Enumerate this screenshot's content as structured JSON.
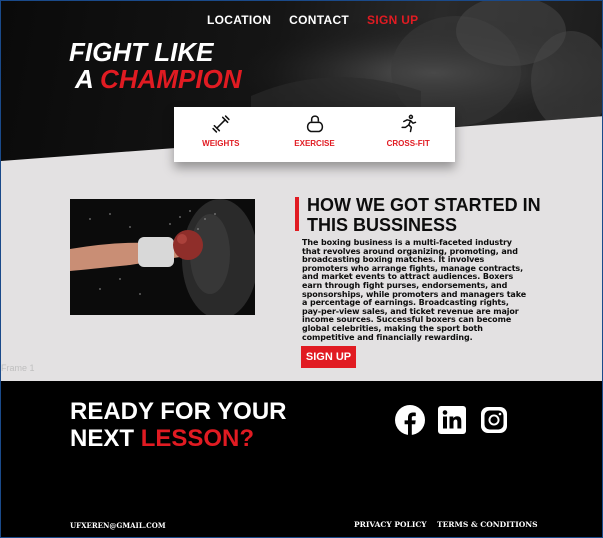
{
  "nav": {
    "items": [
      "LOCATION",
      "CONTACT",
      "SIGN UP"
    ]
  },
  "hero": {
    "line1": "FIGHT LIKE",
    "line2_prefix": "A",
    "line2_accent": "CHAMPION"
  },
  "services": [
    {
      "label": "WEIGHTS",
      "icon": "dumbbell-icon"
    },
    {
      "label": "EXERCISE",
      "icon": "kettlebell-icon"
    },
    {
      "label": "CROSS-FIT",
      "icon": "running-person-icon"
    }
  ],
  "story": {
    "heading": "HOW WE GOT STARTED IN THIS BUSSINESS",
    "body": "The boxing business is a multi-faceted industry that revolves around organizing, promoting, and broadcasting boxing matches. It involves promoters who arrange fights, manage contracts, and market events to attract audiences. Boxers earn through fight purses, endorsements, and sponsorships, while promoters and managers take a percentage of earnings. Broadcasting rights, pay-per-view sales, and ticket revenue are major income sources. Successful boxers can become global celebrities, making the sport both competitive and financially rewarding.",
    "button": "SIGN UP"
  },
  "frame_label": "Frame 1",
  "footer": {
    "cta_line1": "READY FOR YOUR",
    "cta_line2_prefix": "NEXT",
    "cta_line2_accent": "LESSON?",
    "socials": [
      "facebook-icon",
      "linkedin-icon",
      "instagram-icon"
    ],
    "email": "UFXEREN@GMAIL.COM",
    "privacy": "PRIVACY POLICY",
    "terms": "TERMS & CONDITIONS"
  },
  "colors": {
    "accent": "#e11b22",
    "dark": "#000000",
    "light_bg": "#e3e1e2"
  }
}
